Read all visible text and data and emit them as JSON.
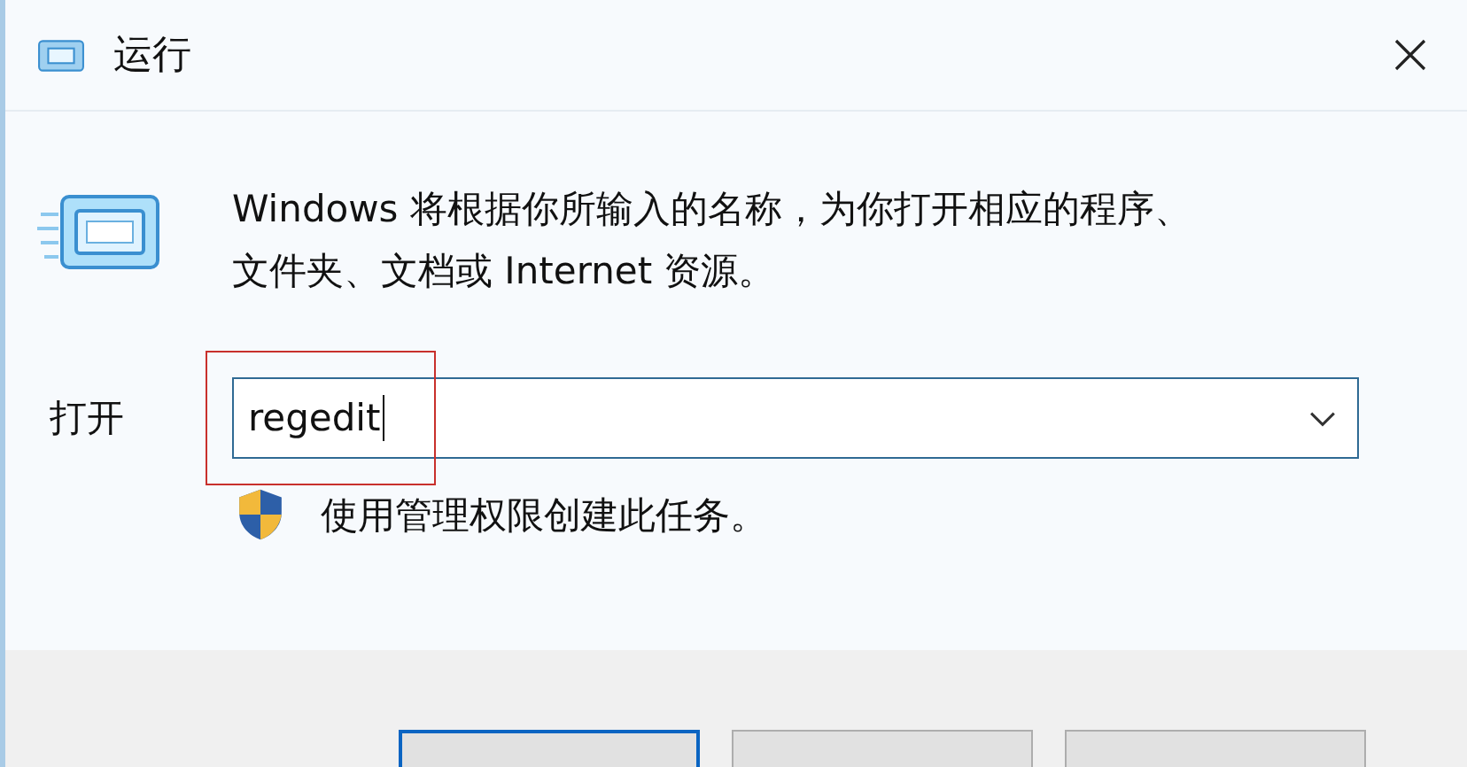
{
  "window": {
    "title": "运行"
  },
  "message": "Windows 将根据你所输入的名称，为你打开相应的程序、文件夹、文档或 Internet 资源。",
  "open_field": {
    "label": "打开",
    "value": "regedit",
    "highlighted": true
  },
  "admin_note": "使用管理权限创建此任务。",
  "buttons": [
    {
      "default": true
    },
    {
      "default": false
    },
    {
      "default": false
    }
  ]
}
